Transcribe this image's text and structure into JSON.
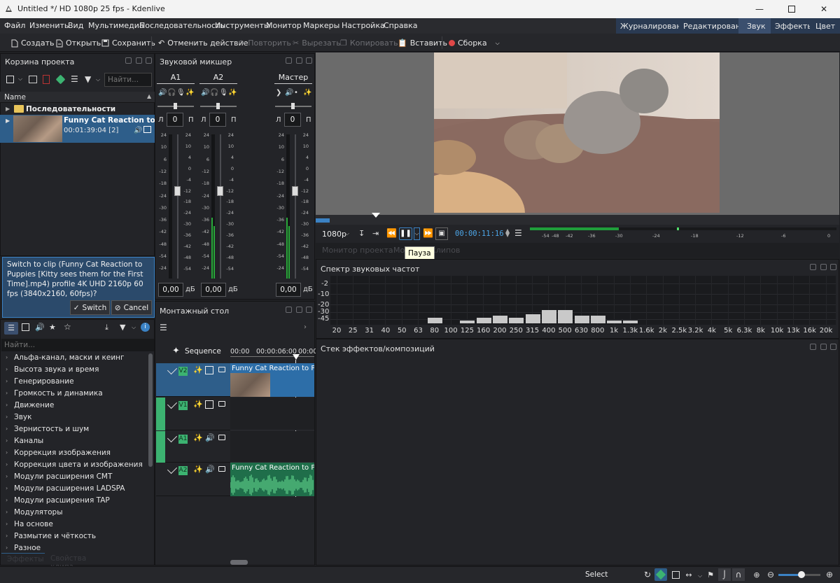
{
  "window": {
    "title": "Untitled */ HD 1080p 25 fps - Kdenlive"
  },
  "menu": [
    "Файл",
    "Изменить",
    "Вид",
    "Мультимедиа",
    "Последовательность",
    "Инструменты",
    "Монитор",
    "Маркеры",
    "Настройка",
    "Справка"
  ],
  "modes": [
    {
      "label": "Журналирование",
      "active": false
    },
    {
      "label": "Редактирование",
      "active": false
    },
    {
      "label": "Звук",
      "active": true
    },
    {
      "label": "Эффекты",
      "active": false
    },
    {
      "label": "Цвет",
      "active": false
    }
  ],
  "toolbar": {
    "create": "Создать",
    "open": "Открыть",
    "save": "Сохранить",
    "undo": "Отменить действие",
    "redo": "Повторить",
    "cut": "Вырезать",
    "copy": "Копировать",
    "paste": "Вставить",
    "render": "Сборка"
  },
  "bin": {
    "title": "Корзина проекта",
    "search_placeholder": "Найти...",
    "column": "Name",
    "folder": "Последовательности",
    "clip_name": "Funny Cat Reaction to Pupp",
    "clip_meta": "00:01:39:04 [2]"
  },
  "switch_dialog": {
    "message": "Switch to clip (Funny Cat Reaction to Puppies [Kitty sees them for the First Time].mp4) profile 4K UHD 2160p 60 fps (3840x2160, 60fps)?",
    "switch": "Switch",
    "cancel": "Cancel"
  },
  "effects": {
    "search_placeholder": "Найти...",
    "categories": [
      "Альфа-канал, маски и кеинг",
      "Высота звука и время",
      "Генерирование",
      "Громкость и динамика",
      "Движение",
      "Звук",
      "Зернистость и шум",
      "Каналы",
      "Коррекция изображения",
      "Коррекция цвета и изображения",
      "Модули расширения CMT",
      "Модули расширения LADSPA",
      "Модули расширения TAP",
      "Модуляторы",
      "На основе",
      "Размытие и чёткость",
      "Разное"
    ],
    "tab_effects": "Эффекты",
    "tab_clip_props": "Свойства клипа"
  },
  "mixer": {
    "title": "Звуковой микшер",
    "strips": [
      {
        "name": "A1",
        "left": "Л",
        "pan": "0",
        "right": "П",
        "gain": "0,00",
        "unit": "дБ",
        "level": 0
      },
      {
        "name": "A2",
        "left": "Л",
        "pan": "0",
        "right": "П",
        "gain": "0,00",
        "unit": "дБ",
        "level": 0.42
      },
      {
        "name": "Мастер",
        "left": "Л",
        "pan": "0",
        "right": "П",
        "gain": "0,00",
        "unit": "дБ",
        "level": 0.42
      }
    ],
    "scale": [
      "24",
      "10",
      "4",
      "0",
      "-4",
      "-12",
      "-18",
      "-24",
      "-30",
      "-36",
      "-42",
      "-48",
      "-54"
    ],
    "meter_scale": [
      "24",
      "10",
      "6",
      "-12",
      "-18",
      "-24",
      "-30",
      "-36",
      "-42",
      "-48",
      "-54",
      "-24"
    ]
  },
  "timeline": {
    "title": "Монтажный стол",
    "sequence": "Sequence",
    "ruler": [
      "00:00",
      "00:00:06:00",
      "00:00"
    ],
    "tracks": [
      {
        "name": "V2",
        "clip": "Funny Cat Reaction to Pup"
      },
      {
        "name": "V1",
        "clip": ""
      },
      {
        "name": "A1",
        "clip": ""
      },
      {
        "name": "A2",
        "clip": "Funny Cat Reaction to Pup"
      }
    ]
  },
  "monitor": {
    "resolution": "1080p",
    "timecode": "00:00:11:16",
    "tooltip": "Пауза",
    "tab_project": "Монитор проекта",
    "tab_clip": "Монитор клипов",
    "meter_scale": [
      "-54",
      "-48",
      "-42",
      "-36",
      "-30",
      "-24",
      "-18",
      "-12",
      "-6",
      "0"
    ],
    "level": 0.29
  },
  "spectrum": {
    "title": "Спектр звуковых частот",
    "y_labels": [
      "-2",
      "-10",
      "-20",
      "-30",
      "-45"
    ],
    "x_labels": [
      "20",
      "25",
      "31",
      "40",
      "50",
      "63",
      "80",
      "100",
      "125",
      "160",
      "200",
      "250",
      "315",
      "400",
      "500",
      "630",
      "800",
      "1k",
      "1.3k",
      "1.6k",
      "2k",
      "2.5k",
      "3.2k",
      "4k",
      "5k",
      "6.3k",
      "8k",
      "10k",
      "13k",
      "16k",
      "20k"
    ]
  },
  "effect_stack": {
    "title": "Стек эффектов/композиций"
  },
  "status": {
    "mode": "Select"
  },
  "colors": {
    "accent": "#3b82c4",
    "track_green": "#3cb371",
    "clip_blue": "#2d6ea8",
    "audio_green": "#1f7a4d"
  }
}
